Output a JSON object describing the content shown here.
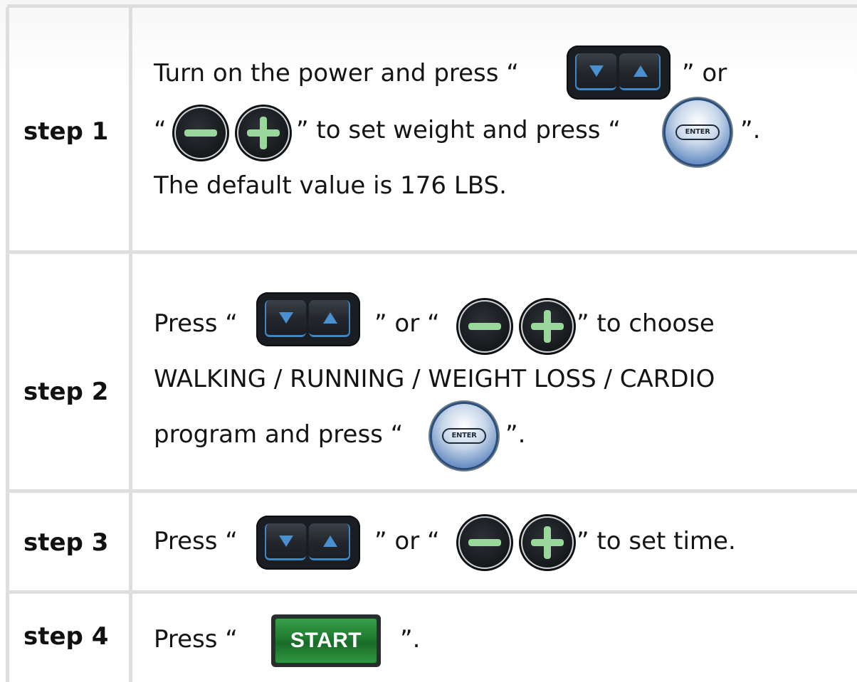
{
  "steps": [
    {
      "label": "step 1",
      "lines": [
        [
          "Turn on the power and press “",
          "” or"
        ],
        [
          "“",
          "” to set weight and press  “",
          "”."
        ],
        [
          "The default value is 176 LBS."
        ]
      ]
    },
    {
      "label": "step 2",
      "lines": [
        [
          "Press “",
          "” or “",
          "” to choose"
        ],
        [
          "WALKING / RUNNING / WEIGHT LOSS / CARDIO"
        ],
        [
          "program and press “",
          "”."
        ]
      ]
    },
    {
      "label": "step 3",
      "lines": [
        [
          "Press “",
          "” or “",
          "” to set time."
        ]
      ]
    },
    {
      "label": "step 4",
      "lines": [
        [
          "Press  “",
          "”."
        ]
      ]
    }
  ],
  "buttons": {
    "enter_label": "ENTER",
    "start_label": "START"
  },
  "colors": {
    "accent_blue": "#3f86c4",
    "plus_minus_green": "#9ad79a",
    "start_green": "#1f7a30",
    "grid": "#dedede"
  },
  "icons": {
    "updown": "up-down-rocker-icon",
    "minus": "minus-icon",
    "plus": "plus-icon",
    "enter": "enter-button-icon",
    "start": "start-button-icon"
  }
}
